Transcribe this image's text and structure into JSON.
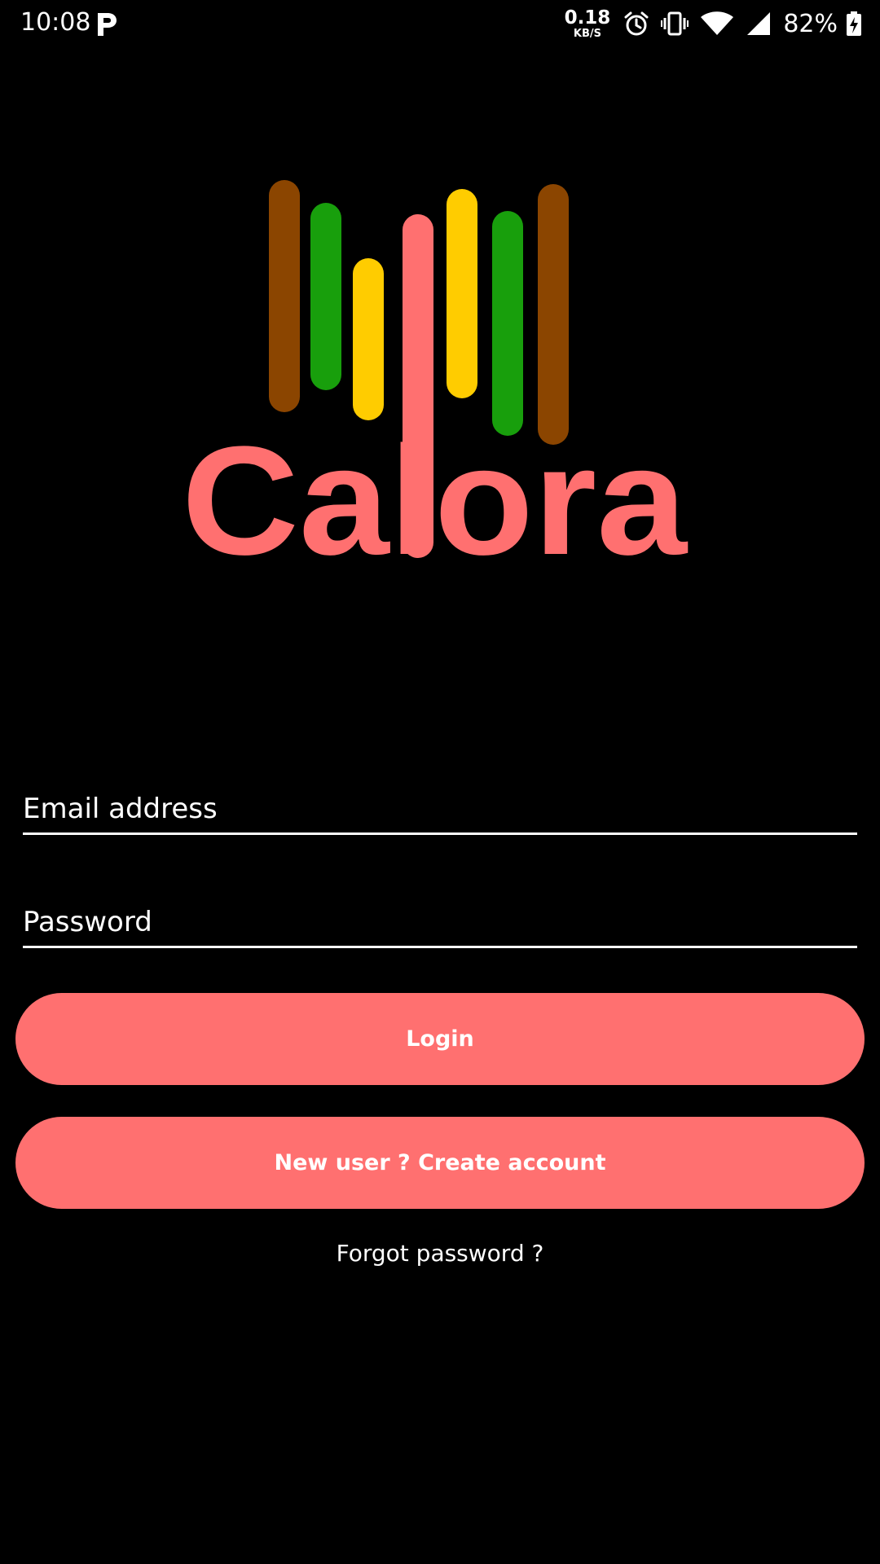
{
  "status_bar": {
    "time": "10:08",
    "net_speed_value": "0.18",
    "net_speed_unit": "KB/S",
    "battery_percent": "82%",
    "icons": [
      "p-app-icon",
      "alarm-icon",
      "vibrate-icon",
      "wifi-icon",
      "cell-signal-icon",
      "battery-charging-icon"
    ]
  },
  "logo": {
    "wordmark": "Calora",
    "colors": {
      "brown": "#8b4500",
      "green": "#189f0c",
      "yellow": "#ffcc00",
      "coral": "#ff7070"
    }
  },
  "form": {
    "email_placeholder": "Email address",
    "password_placeholder": "Password",
    "login_label": "Login",
    "create_account_label": "New user ? Create account",
    "forgot_password_label": "Forgot password ?"
  },
  "theme": {
    "background": "#000000",
    "accent": "#ff7070",
    "text": "#ffffff"
  }
}
